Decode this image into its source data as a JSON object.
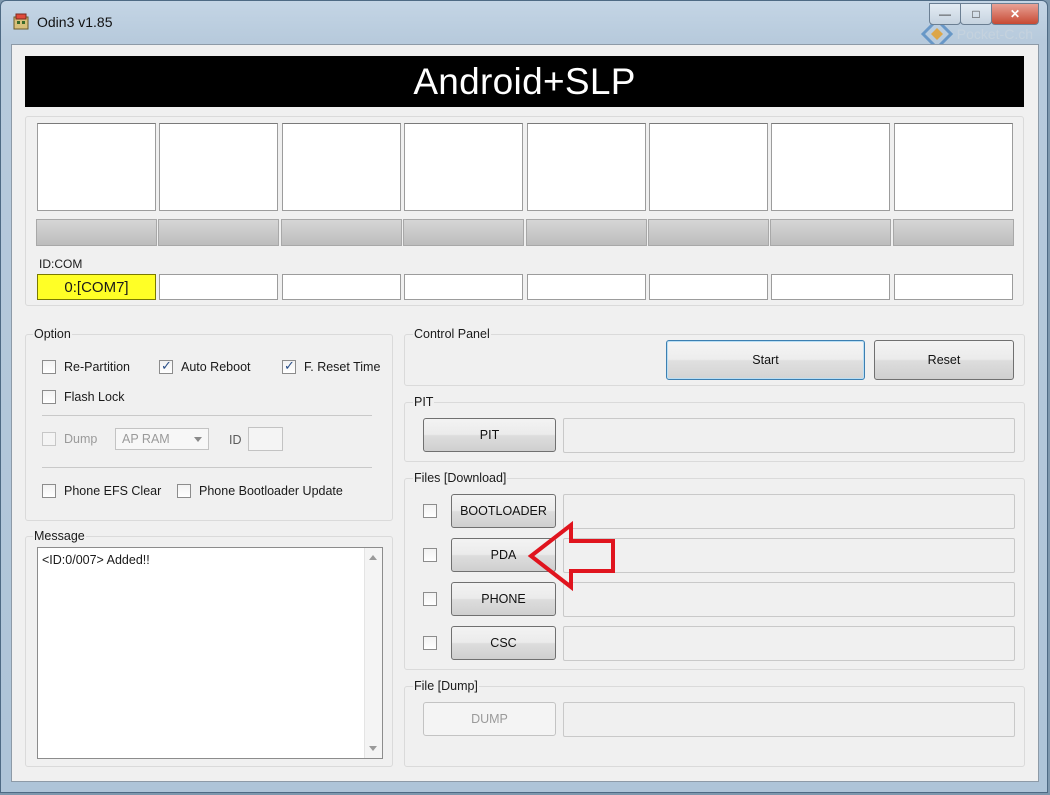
{
  "window": {
    "title": "Odin3 v1.85",
    "watermark": "Pocket-C.ch"
  },
  "banner": {
    "text": "Android+SLP"
  },
  "ports": {
    "id_com_label": "ID:COM",
    "ids": [
      "0:[COM7]",
      "",
      "",
      "",
      "",
      "",
      "",
      ""
    ]
  },
  "option": {
    "title": "Option",
    "re_partition": {
      "label": "Re-Partition",
      "checked": false
    },
    "auto_reboot": {
      "label": "Auto Reboot",
      "checked": true
    },
    "f_reset_time": {
      "label": "F. Reset Time",
      "checked": true
    },
    "flash_lock": {
      "label": "Flash Lock",
      "checked": false
    },
    "dump": {
      "label": "Dump",
      "checked": false
    },
    "dump_combo": "AP RAM",
    "id_label": "ID",
    "phone_efs_clear": {
      "label": "Phone EFS Clear",
      "checked": false
    },
    "phone_bootloader_update": {
      "label": "Phone Bootloader Update",
      "checked": false
    }
  },
  "message": {
    "title": "Message",
    "text": "<ID:0/007> Added!!"
  },
  "control_panel": {
    "title": "Control Panel",
    "start_label": "Start",
    "reset_label": "Reset"
  },
  "pit": {
    "title": "PIT",
    "button_label": "PIT"
  },
  "files_download": {
    "title": "Files [Download]",
    "bootloader_label": "BOOTLOADER",
    "pda_label": "PDA",
    "phone_label": "PHONE",
    "csc_label": "CSC"
  },
  "file_dump": {
    "title": "File [Dump]",
    "button_label": "DUMP"
  },
  "colors": {
    "active_port": "#ffff26",
    "annotation_arrow": "#e0141e",
    "banner": "#000000"
  }
}
